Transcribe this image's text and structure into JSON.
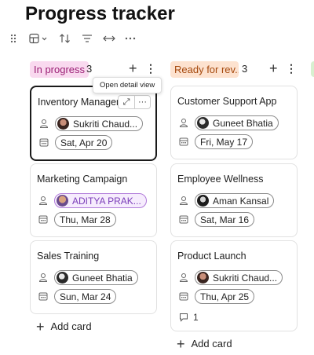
{
  "page": {
    "title": "Progress tracker"
  },
  "toolbar": {
    "icons": [
      "drag-handle-icon",
      "board-view-icon",
      "sort-icon",
      "filter-icon",
      "expand-icon",
      "more-icon"
    ]
  },
  "tooltip": {
    "text": "Open detail view"
  },
  "columns": [
    {
      "label": "In progress",
      "count": "3",
      "color": "#f9d9ef",
      "text_color": "#9b1f75",
      "add_card_label": "Add card",
      "cards": [
        {
          "title": "Inventory Management",
          "assignee": "Sukriti Chaud...",
          "date": "Sat, Apr 20"
        },
        {
          "title": "Marketing Campaign",
          "assignee": "ADITYA PRAK...",
          "date": "Thu, Mar 28"
        },
        {
          "title": "Sales Training",
          "assignee": "Guneet Bhatia",
          "date": "Sun, Mar 24"
        }
      ]
    },
    {
      "label": "Ready for rev...",
      "count": "3",
      "color": "#fde2cf",
      "text_color": "#a5480c",
      "add_card_label": "Add card",
      "cards": [
        {
          "title": "Customer Support App",
          "assignee": "Guneet Bhatia",
          "date": "Fri, May 17"
        },
        {
          "title": "Employee Wellness",
          "assignee": "Aman Kansal",
          "date": "Sat, Mar 16"
        },
        {
          "title": "Product Launch",
          "assignee": "Sukriti Chaud...",
          "date": "Thu, Apr 25",
          "comments": "1"
        }
      ]
    }
  ]
}
